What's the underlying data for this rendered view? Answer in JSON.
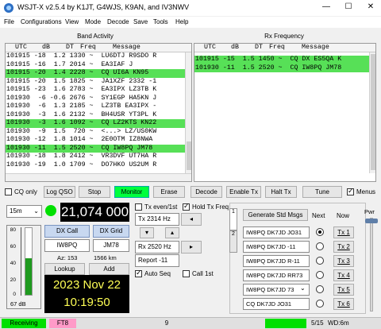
{
  "window": {
    "title": "WSJT-X  v2.5.4  by K1JT, G4WJS, K9AN, and IV3NWV",
    "min": "—",
    "max": "☐",
    "close": "✕"
  },
  "menu": [
    "File",
    "Configurations",
    "View",
    "Mode",
    "Decode",
    "Save",
    "Tools",
    "Help"
  ],
  "band_activity": {
    "title": "Band Activity",
    "headers": [
      "UTC",
      "dB",
      "DT",
      "Freq",
      "Message"
    ],
    "rows": [
      {
        "text": "101915 -18  1.2 1330 ~  LU6DTJ R9SDO R",
        "hl": false
      },
      {
        "text": "101915 -16  1.7 2014 ~  EA3IAF J",
        "hl": false
      },
      {
        "text": "101915 -20  1.4 2228 ~  CQ UI6A KN95",
        "hl": true
      },
      {
        "text": "101915 -20  1.5 1825 ~  JA1XZF 2332 -1",
        "hl": false
      },
      {
        "text": "101915 -23  1.6 2783 ~  EA3IPX LZ3TB K",
        "hl": false
      },
      {
        "text": "101930  -6 -0.6 2676 ~  SY1EGP HA5KN J",
        "hl": false
      },
      {
        "text": "101930  -6  1.3 2185 ~  LZ3TB EA3IPX -",
        "hl": false
      },
      {
        "text": "101930  -3  1.6 2132 ~  BH4USR YT3PL K",
        "hl": false
      },
      {
        "text": "101930  -3  1.6 1092 ~  CQ LZ2KTS KN22",
        "hl": true
      },
      {
        "text": "101930  -9  1.5  720 ~  <...> LZ/US0KW",
        "hl": false
      },
      {
        "text": "101930 -12  1.8 1014 ~  2E0OTM IZ8NWA",
        "hl": false
      },
      {
        "text": "101930 -11  1.5 2520 ~  CQ IW8PQ JM78",
        "hl": true
      },
      {
        "text": "101930 -18  1.8 2412 ~  VR3DVF UT7HA R",
        "hl": false
      },
      {
        "text": "101930 -19  1.0 1709 ~  DO7HKO US2UM R",
        "hl": false
      }
    ]
  },
  "rx_frequency": {
    "title": "Rx Frequency",
    "headers": [
      "UTC",
      "dB",
      "DT",
      "Freq",
      "Message"
    ],
    "rows": [
      {
        "text": "101915 -15  1.5 1450 ~  CQ DX ES5QA K",
        "hl": true
      },
      {
        "text": "101930 -11  1.5 2520 ~  CQ IW8PQ JM78",
        "hl": true
      }
    ]
  },
  "controls": {
    "cq_only": "CQ only",
    "log_qso": "Log QSO",
    "stop": "Stop",
    "monitor": "Monitor",
    "erase": "Erase",
    "decode": "Decode",
    "enable_tx": "Enable Tx",
    "halt_tx": "Halt Tx",
    "tune": "Tune",
    "menus": "Menus"
  },
  "band": "15m",
  "frequency": "21,074 000",
  "tx_even": "Tx even/1st",
  "hold_tx_freq": "Hold Tx Freq",
  "tx_freq": "Tx  2314  Hz",
  "rx_freq": "Rx  2520  Hz",
  "report": "Report -11",
  "auto_seq": "Auto Seq",
  "call_1st": "Call 1st",
  "dx_call_label": "DX Call",
  "dx_grid_label": "DX Grid",
  "dx_call": "IW8PQ",
  "dx_grid": "JM78",
  "az": "Az: 153",
  "distance": "1566 km",
  "lookup": "Lookup",
  "add": "Add",
  "date": "2023 Nov 22",
  "time": "10:19:50",
  "meter": {
    "ticks": [
      "80",
      "60",
      "40",
      "20",
      "0"
    ],
    "level_db": "67 dB",
    "level_fraction": 0.55
  },
  "tx_panel": {
    "generate": "Generate Std Msgs",
    "next": "Next",
    "now": "Now",
    "messages": [
      "IW8PQ DK7JD JO31",
      "IW8PQ DK7JD -11",
      "IW8PQ DK7JD R-11",
      "IW8PQ DK7JD RR73",
      "IW8PQ DK7JD 73",
      "CQ DK7JD JO31"
    ],
    "tx_buttons": [
      "Tx 1",
      "Tx 2",
      "Tx 3",
      "Tx 4",
      "Tx 5",
      "Tx 6"
    ],
    "tab1": "1",
    "tab2": "2",
    "pwr": "Pwr"
  },
  "status": {
    "receiving": "Receiving",
    "mode": "FT8",
    "count": "9",
    "page": "5/15",
    "wd": "WD:6m"
  }
}
